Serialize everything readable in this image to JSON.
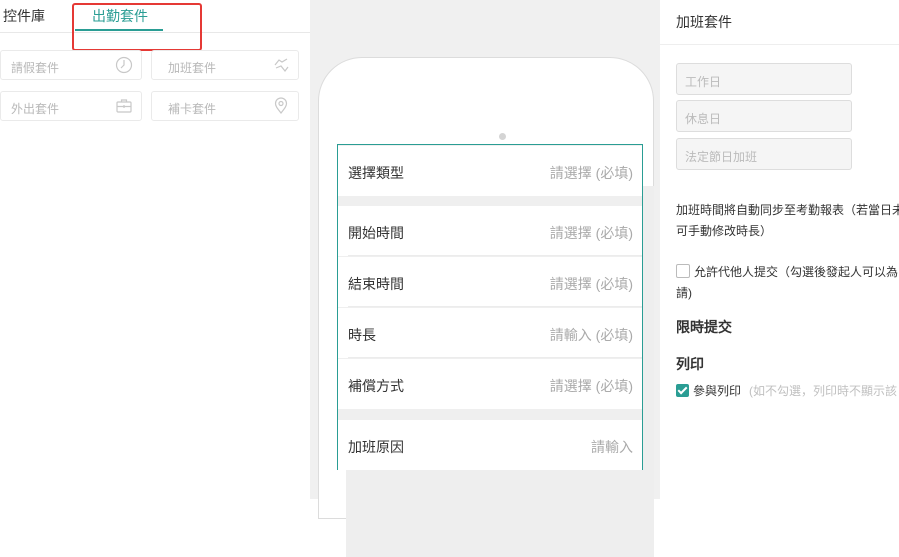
{
  "left": {
    "tabs": [
      "控件庫",
      "出勤套件"
    ],
    "kits": [
      {
        "label": "請假套件",
        "icon": "clock-icon"
      },
      {
        "label": "加班套件",
        "icon": "hand-icon"
      },
      {
        "label": "外出套件",
        "icon": "briefcase-icon"
      },
      {
        "label": "補卡套件",
        "icon": "location-pin-icon"
      }
    ]
  },
  "form": {
    "rows": [
      {
        "label": "選擇類型",
        "value": "請選擇 (必填)"
      },
      {
        "label": "開始時間",
        "value": "請選擇 (必填)"
      },
      {
        "label": "結束時間",
        "value": "請選擇 (必填)"
      },
      {
        "label": "時長",
        "value": "請輸入 (必填)"
      },
      {
        "label": "補償方式",
        "value": "請選擇 (必填)"
      },
      {
        "label": "加班原因",
        "value": "請輸入"
      }
    ]
  },
  "right": {
    "title": "加班套件",
    "chips": [
      "工作日",
      "休息日",
      "法定節日加班"
    ],
    "note_line1": "加班時間將自動同步至考勤報表（若當日未",
    "note_line2": "可手動修改時長）",
    "allow_line1": "允許代他人提交（勾選後發起人可以為",
    "allow_line2": "請)",
    "limit_title": "限時提交",
    "print_title": "列印",
    "print_label": "參與列印",
    "print_hint": "(如不勾選，列印時不顯示該"
  },
  "colors": {
    "accent": "#2a9d94",
    "highlight": "#e53935"
  }
}
